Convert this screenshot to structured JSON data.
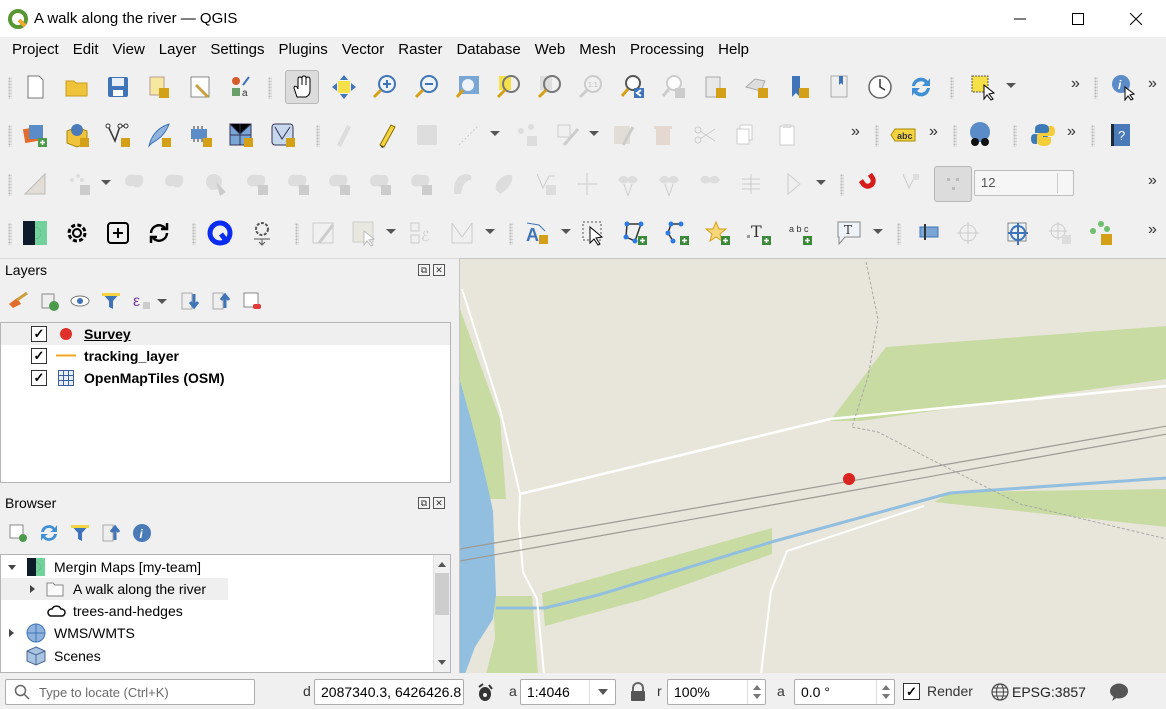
{
  "window": {
    "title": "A walk along the river — QGIS",
    "controls": [
      "minimize",
      "maximize",
      "close"
    ]
  },
  "menubar": {
    "items": [
      {
        "label": "Project"
      },
      {
        "label": "Edit"
      },
      {
        "label": "View"
      },
      {
        "label": "Layer"
      },
      {
        "label": "Settings"
      },
      {
        "label": "Plugins"
      },
      {
        "label": "Vector"
      },
      {
        "label": "Raster"
      },
      {
        "label": "Database"
      },
      {
        "label": "Web"
      },
      {
        "label": "Mesh"
      },
      {
        "label": "Processing"
      },
      {
        "label": "Help"
      }
    ]
  },
  "toolbars": {
    "row1": [
      "new-project",
      "open-project",
      "save-project",
      "new-print-layout",
      "layout-manager",
      "style-manager",
      "pan-map",
      "pan-to-selection",
      "zoom-in",
      "zoom-out",
      "zoom-full",
      "zoom-to-selection",
      "zoom-to-layer",
      "zoom-native",
      "zoom-last",
      "zoom-next",
      "new-map-view",
      "new-3d-map-view",
      "new-spatial-bookmark",
      "show-bookmarks",
      "temporal-controller",
      "refresh",
      "select-features",
      "identify-features"
    ],
    "row2": [
      "data-source-manager",
      "new-geopackage-layer",
      "new-shapefile-layer",
      "new-spatialite-layer",
      "new-virtual-layer",
      "new-mesh-layer",
      "new-gpx-layer",
      "current-edits",
      "toggle-editing",
      "save-layer-edits",
      "digitize",
      "vertex-tool",
      "modify-attributes",
      "delete-selected",
      "cut-features",
      "copy-features",
      "paste-features",
      "label-toolbar",
      "metasearch",
      "python-console",
      "help"
    ],
    "row3": [
      "measure",
      "move-feature",
      "rotate-feature",
      "simplify-feature",
      "add-ring",
      "add-part",
      "fill-ring",
      "delete-ring",
      "delete-part",
      "reshape",
      "offset-curve",
      "reverse-line",
      "trim-extend",
      "split-features",
      "split-parts",
      "merge-features",
      "merge-attributes",
      "rotate-point-symbols",
      "snapping",
      "tracing",
      "snapping-config"
    ],
    "row4": [
      "mergin-maps",
      "mergin-settings",
      "mergin-create",
      "mergin-sync",
      "qfield-sync",
      "qfield-settings",
      "annotation-edit",
      "annotation-select",
      "annotation-nodes",
      "annotation-mesh",
      "label-style",
      "select-annotation",
      "polygon-annotation",
      "line-annotation",
      "marker-annotation",
      "text-annotation",
      "text-along-line",
      "text-bubble",
      "pin-labels",
      "show-hide-labels",
      "georeferencer",
      "add-point-feature",
      "cluster"
    ],
    "snapping_tolerance": "12",
    "overflow_label": "»"
  },
  "layers_panel": {
    "title": "Layers",
    "layers": [
      {
        "name": "Survey",
        "checked": true,
        "symbol": "point",
        "color": "#e0302a",
        "selected": true
      },
      {
        "name": "tracking_layer",
        "checked": true,
        "symbol": "line",
        "color": "#f5a623",
        "selected": false
      },
      {
        "name": "OpenMapTiles (OSM)",
        "checked": true,
        "symbol": "raster-grid",
        "color": "#3a5fa0",
        "selected": false
      }
    ]
  },
  "browser_panel": {
    "title": "Browser",
    "items": [
      {
        "label": "Mergin Maps [my-team]",
        "icon": "mergin-icon",
        "expanded": true,
        "level": 0
      },
      {
        "label": "A walk along the river",
        "icon": "folder-icon",
        "expanded": false,
        "level": 1,
        "selected": true
      },
      {
        "label": "trees-and-hedges",
        "icon": "cloud-icon",
        "level": 1
      },
      {
        "label": "WMS/WMTS",
        "icon": "globe-icon",
        "expanded": false,
        "level": 0
      },
      {
        "label": "Scenes",
        "icon": "cube-icon",
        "level": 0
      }
    ]
  },
  "map": {
    "colors": {
      "background": "#e8e5da",
      "water": "#92bfe0",
      "vegetation": "#c8dba2",
      "road": "#ffffff",
      "rail": "#9d9a94",
      "boundary": "#a8a8a8",
      "survey_point": "#d9241f"
    }
  },
  "statusbar": {
    "locator_placeholder": "Type to locate (Ctrl+K)",
    "coordinate_label": "d",
    "coordinate": "2087340.3, 6426426.8",
    "scale_label": "a",
    "scale": "1:4046",
    "magnifier_label": "r",
    "magnifier": "100%",
    "rotation_label": "a",
    "rotation": "0.0 °",
    "render_label": "Render",
    "render_checked": true,
    "crs": "EPSG:3857"
  }
}
